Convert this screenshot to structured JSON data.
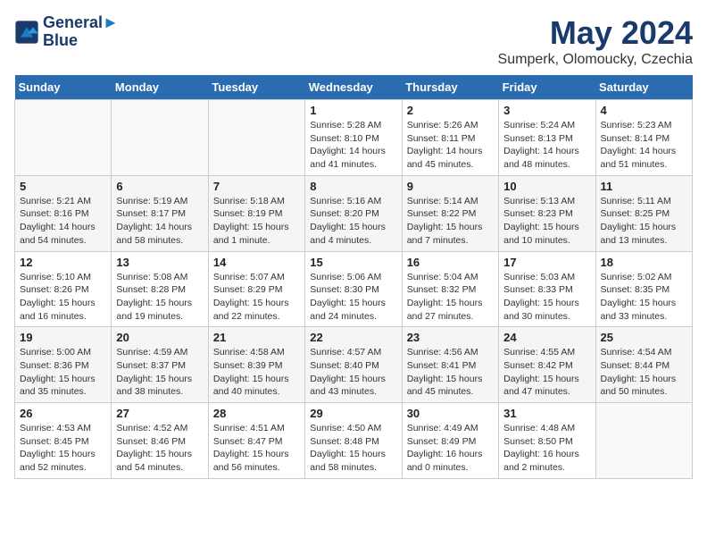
{
  "logo": {
    "line1": "General",
    "line2": "Blue"
  },
  "title": "May 2024",
  "subtitle": "Sumperk, Olomoucky, Czechia",
  "days_header": [
    "Sunday",
    "Monday",
    "Tuesday",
    "Wednesday",
    "Thursday",
    "Friday",
    "Saturday"
  ],
  "weeks": [
    [
      {
        "day": "",
        "info": ""
      },
      {
        "day": "",
        "info": ""
      },
      {
        "day": "",
        "info": ""
      },
      {
        "day": "1",
        "info": "Sunrise: 5:28 AM\nSunset: 8:10 PM\nDaylight: 14 hours\nand 41 minutes."
      },
      {
        "day": "2",
        "info": "Sunrise: 5:26 AM\nSunset: 8:11 PM\nDaylight: 14 hours\nand 45 minutes."
      },
      {
        "day": "3",
        "info": "Sunrise: 5:24 AM\nSunset: 8:13 PM\nDaylight: 14 hours\nand 48 minutes."
      },
      {
        "day": "4",
        "info": "Sunrise: 5:23 AM\nSunset: 8:14 PM\nDaylight: 14 hours\nand 51 minutes."
      }
    ],
    [
      {
        "day": "5",
        "info": "Sunrise: 5:21 AM\nSunset: 8:16 PM\nDaylight: 14 hours\nand 54 minutes."
      },
      {
        "day": "6",
        "info": "Sunrise: 5:19 AM\nSunset: 8:17 PM\nDaylight: 14 hours\nand 58 minutes."
      },
      {
        "day": "7",
        "info": "Sunrise: 5:18 AM\nSunset: 8:19 PM\nDaylight: 15 hours\nand 1 minute."
      },
      {
        "day": "8",
        "info": "Sunrise: 5:16 AM\nSunset: 8:20 PM\nDaylight: 15 hours\nand 4 minutes."
      },
      {
        "day": "9",
        "info": "Sunrise: 5:14 AM\nSunset: 8:22 PM\nDaylight: 15 hours\nand 7 minutes."
      },
      {
        "day": "10",
        "info": "Sunrise: 5:13 AM\nSunset: 8:23 PM\nDaylight: 15 hours\nand 10 minutes."
      },
      {
        "day": "11",
        "info": "Sunrise: 5:11 AM\nSunset: 8:25 PM\nDaylight: 15 hours\nand 13 minutes."
      }
    ],
    [
      {
        "day": "12",
        "info": "Sunrise: 5:10 AM\nSunset: 8:26 PM\nDaylight: 15 hours\nand 16 minutes."
      },
      {
        "day": "13",
        "info": "Sunrise: 5:08 AM\nSunset: 8:28 PM\nDaylight: 15 hours\nand 19 minutes."
      },
      {
        "day": "14",
        "info": "Sunrise: 5:07 AM\nSunset: 8:29 PM\nDaylight: 15 hours\nand 22 minutes."
      },
      {
        "day": "15",
        "info": "Sunrise: 5:06 AM\nSunset: 8:30 PM\nDaylight: 15 hours\nand 24 minutes."
      },
      {
        "day": "16",
        "info": "Sunrise: 5:04 AM\nSunset: 8:32 PM\nDaylight: 15 hours\nand 27 minutes."
      },
      {
        "day": "17",
        "info": "Sunrise: 5:03 AM\nSunset: 8:33 PM\nDaylight: 15 hours\nand 30 minutes."
      },
      {
        "day": "18",
        "info": "Sunrise: 5:02 AM\nSunset: 8:35 PM\nDaylight: 15 hours\nand 33 minutes."
      }
    ],
    [
      {
        "day": "19",
        "info": "Sunrise: 5:00 AM\nSunset: 8:36 PM\nDaylight: 15 hours\nand 35 minutes."
      },
      {
        "day": "20",
        "info": "Sunrise: 4:59 AM\nSunset: 8:37 PM\nDaylight: 15 hours\nand 38 minutes."
      },
      {
        "day": "21",
        "info": "Sunrise: 4:58 AM\nSunset: 8:39 PM\nDaylight: 15 hours\nand 40 minutes."
      },
      {
        "day": "22",
        "info": "Sunrise: 4:57 AM\nSunset: 8:40 PM\nDaylight: 15 hours\nand 43 minutes."
      },
      {
        "day": "23",
        "info": "Sunrise: 4:56 AM\nSunset: 8:41 PM\nDaylight: 15 hours\nand 45 minutes."
      },
      {
        "day": "24",
        "info": "Sunrise: 4:55 AM\nSunset: 8:42 PM\nDaylight: 15 hours\nand 47 minutes."
      },
      {
        "day": "25",
        "info": "Sunrise: 4:54 AM\nSunset: 8:44 PM\nDaylight: 15 hours\nand 50 minutes."
      }
    ],
    [
      {
        "day": "26",
        "info": "Sunrise: 4:53 AM\nSunset: 8:45 PM\nDaylight: 15 hours\nand 52 minutes."
      },
      {
        "day": "27",
        "info": "Sunrise: 4:52 AM\nSunset: 8:46 PM\nDaylight: 15 hours\nand 54 minutes."
      },
      {
        "day": "28",
        "info": "Sunrise: 4:51 AM\nSunset: 8:47 PM\nDaylight: 15 hours\nand 56 minutes."
      },
      {
        "day": "29",
        "info": "Sunrise: 4:50 AM\nSunset: 8:48 PM\nDaylight: 15 hours\nand 58 minutes."
      },
      {
        "day": "30",
        "info": "Sunrise: 4:49 AM\nSunset: 8:49 PM\nDaylight: 16 hours\nand 0 minutes."
      },
      {
        "day": "31",
        "info": "Sunrise: 4:48 AM\nSunset: 8:50 PM\nDaylight: 16 hours\nand 2 minutes."
      },
      {
        "day": "",
        "info": ""
      }
    ]
  ]
}
